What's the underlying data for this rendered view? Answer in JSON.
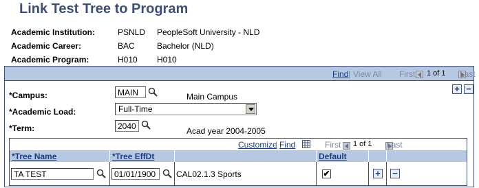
{
  "page": {
    "title": "Link Test Tree to Program"
  },
  "header": {
    "institution": {
      "label": "Academic Institution:",
      "code": "PSNLD",
      "desc": "PeopleSoft University -  NLD"
    },
    "career": {
      "label": "Academic Career:",
      "code": "BAC",
      "desc": "Bachelor (NLD)"
    },
    "program": {
      "label": "Academic Program:",
      "code": "H010",
      "desc": "H010"
    }
  },
  "panel": {
    "find": "Find",
    "sep": "|",
    "view_all": "View All",
    "first": "First",
    "counter": "1 of 1",
    "last": "Last",
    "add": "+",
    "delete": "−"
  },
  "form": {
    "campus": {
      "label": "*Campus:",
      "value": "MAIN",
      "desc": "Main Campus"
    },
    "load": {
      "label": "*Academic Load:",
      "value": "Full-Time"
    },
    "term": {
      "label": "*Term:",
      "value": "2040",
      "desc": "Acad year 2004-2005"
    }
  },
  "grid": {
    "customize": "Customize",
    "sep": "|",
    "find": "Find",
    "first": "First",
    "counter": "1 of 1",
    "last": "Last",
    "columns": {
      "tree_name": "*Tree Name",
      "tree_effdt": "*Tree EffDt",
      "default": "Default"
    },
    "row": {
      "tree_name": "TA TEST",
      "tree_effdt": "01/01/1900",
      "desc": "CAL02.1.3 Sports",
      "default_mark": "✔",
      "add": "+",
      "delete": "−"
    }
  }
}
